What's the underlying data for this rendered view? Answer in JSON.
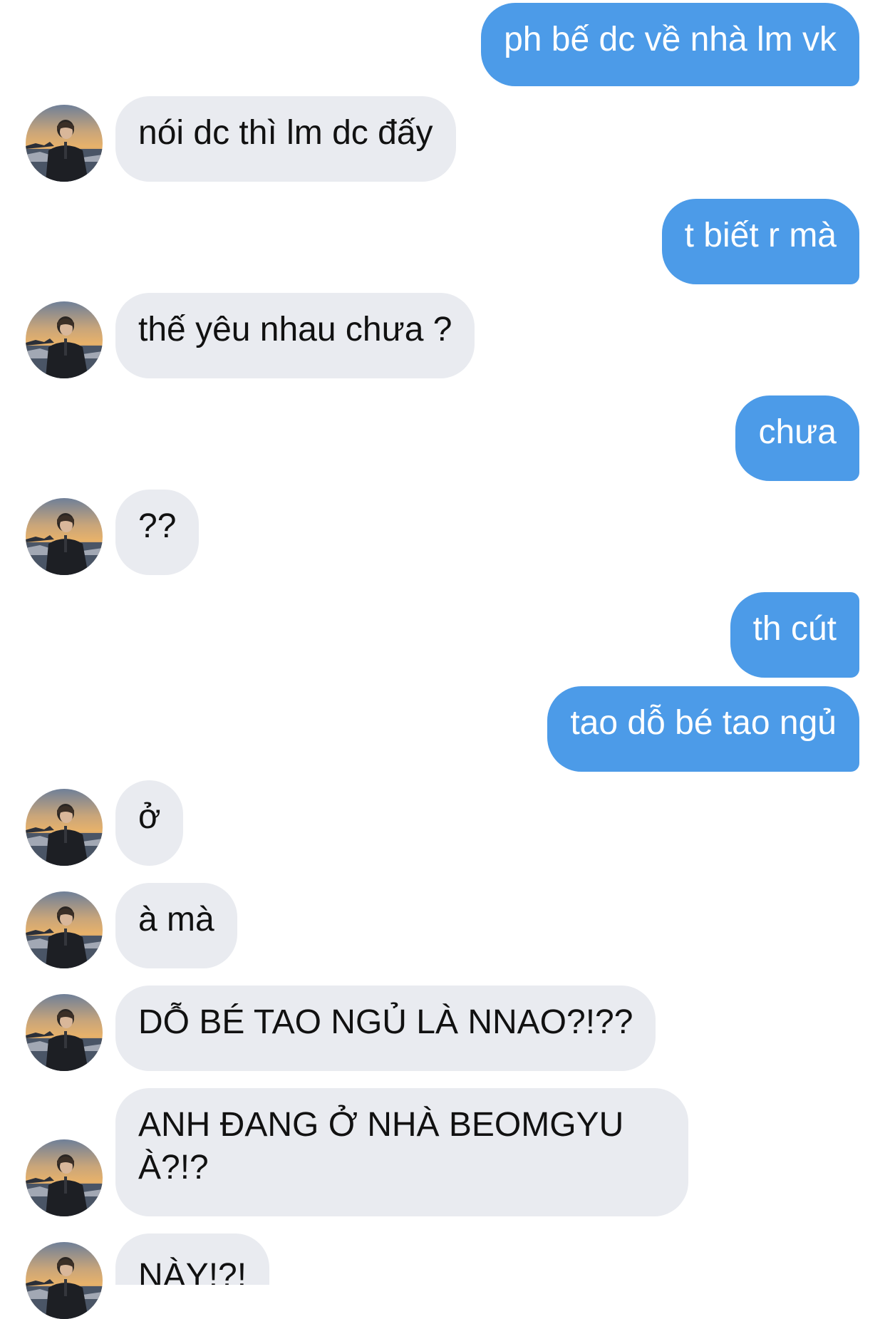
{
  "conversation": {
    "messages": [
      {
        "direction": "outgoing",
        "text": "ph bế dc về nhà lm vk"
      },
      {
        "direction": "incoming",
        "text": "nói dc thì lm dc đấy"
      },
      {
        "direction": "outgoing",
        "text": "t biết r mà"
      },
      {
        "direction": "incoming",
        "text": "thế yêu nhau chưa ?"
      },
      {
        "direction": "outgoing",
        "text": "chưa"
      },
      {
        "direction": "incoming",
        "text": "??"
      },
      {
        "direction": "outgoing",
        "text": "th cút"
      },
      {
        "direction": "outgoing",
        "text": "tao dỗ bé tao ngủ"
      },
      {
        "direction": "incoming",
        "text": "ở"
      },
      {
        "direction": "incoming",
        "text": "à mà"
      },
      {
        "direction": "incoming",
        "text": "DỖ BÉ TAO NGỦ LÀ NNAO?!??"
      },
      {
        "direction": "incoming",
        "text": "ANH ĐANG Ở NHÀ BEOMGYU À?!?"
      },
      {
        "direction": "incoming",
        "text": "NÀY!?!"
      }
    ]
  },
  "colors": {
    "outgoing_bubble": "#4c9be8",
    "incoming_bubble": "#e9ebf0",
    "outgoing_text": "#ffffff",
    "incoming_text": "#111111"
  },
  "icons": {
    "avatar": "contact-avatar-photo"
  }
}
